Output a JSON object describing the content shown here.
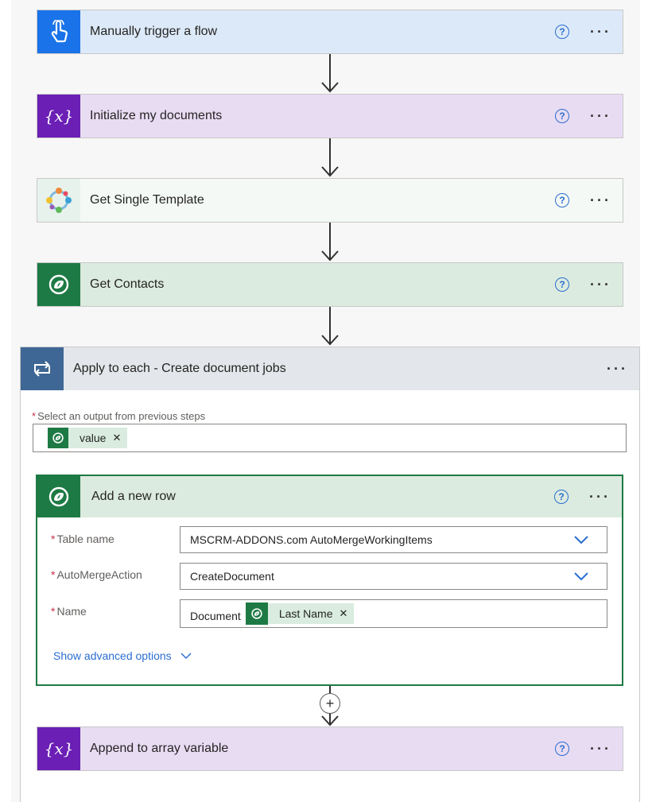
{
  "steps": [
    {
      "title": "Manually trigger a flow"
    },
    {
      "title": "Initialize my documents",
      "icon_text": "{x}"
    },
    {
      "title": "Get Single Template"
    },
    {
      "title": "Get Contacts"
    }
  ],
  "loop": {
    "title": "Apply to each - Create document jobs",
    "select_label": "Select an output from previous steps",
    "select_token": "value",
    "inner": {
      "title": "Add a new row",
      "fields": [
        {
          "label": "Table name",
          "value": "MSCRM-ADDONS.com AutoMergeWorkingItems"
        },
        {
          "label": "AutoMergeAction",
          "value": "CreateDocument"
        },
        {
          "label": "Name",
          "prefix": "Document",
          "token": "Last Name"
        }
      ],
      "advanced": "Show advanced options"
    },
    "append": {
      "title": "Append to array variable",
      "icon_text": "{x}"
    }
  },
  "colors": {
    "trigger_icon": "#1a73e8",
    "trigger_bg": "#dce9f8",
    "variable_icon": "#6b1fb5",
    "variable_bg": "#e8dcf3",
    "dataverse_icon": "#1e7a44",
    "dataverse_bg": "#dcebdf",
    "loop_icon": "#3f6795",
    "loop_bg": "#e3e6ea"
  },
  "icons": [
    "touch-icon",
    "variable-icon",
    "template-icon",
    "dataverse-icon",
    "loop-icon",
    "help-icon",
    "more-icon",
    "remove-icon",
    "chevron-down-icon",
    "add-icon"
  ]
}
